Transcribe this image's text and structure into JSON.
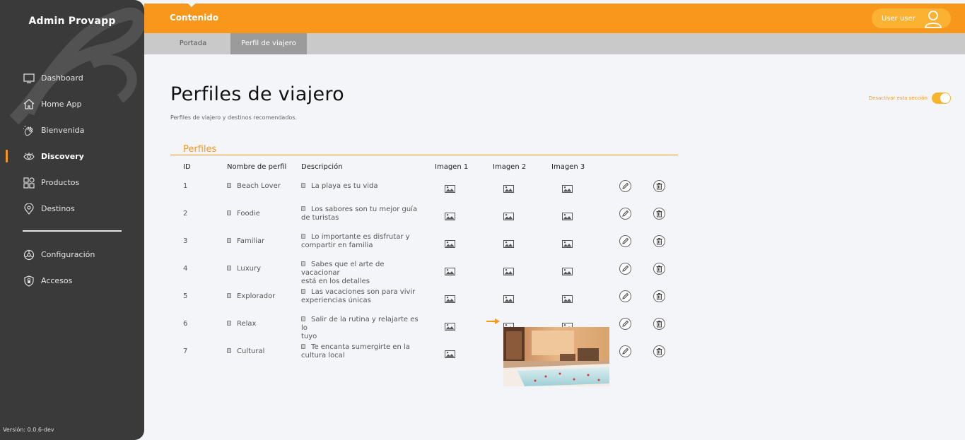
{
  "app": {
    "brand": "Admin Provapp",
    "version": "Versión: 0.0.6-dev"
  },
  "sidebar": {
    "items": [
      {
        "label": "Dashboard",
        "icon": "monitor-icon"
      },
      {
        "label": "Home App",
        "icon": "home-icon"
      },
      {
        "label": "Bienvenida",
        "icon": "wave-hand-icon"
      },
      {
        "label": "Discovery",
        "icon": "eye-icon",
        "active": true
      },
      {
        "label": "Productos",
        "icon": "grid-icon"
      },
      {
        "label": "Destinos",
        "icon": "location-pin-icon"
      }
    ],
    "secondary": [
      {
        "label": "Configuración",
        "icon": "settings-icon"
      },
      {
        "label": "Accesos",
        "icon": "shield-icon"
      }
    ]
  },
  "topbar": {
    "title": "Contenido",
    "user": "User user"
  },
  "tabs": [
    {
      "label": "Portada"
    },
    {
      "label": "Perfil de viajero",
      "active": true
    }
  ],
  "page": {
    "title": "Perfiles de viajero",
    "subtitle": "Perfiles de viajero y destinos recomendados.",
    "toggle_label": "Desactivar esta sección",
    "toggle_on": true
  },
  "section": {
    "title": "Perfiles"
  },
  "table": {
    "headers": {
      "id": "ID",
      "name": "Nombre de perfil",
      "desc": "Descripción",
      "img1": "Imagen 1",
      "img2": "Imagen 2",
      "img3": "Imagen 3"
    },
    "rows": [
      {
        "id": "1",
        "name": "Beach Lover",
        "desc": "La playa es tu vida",
        "desc2": ""
      },
      {
        "id": "2",
        "name": "Foodie",
        "desc": "Los sabores son tu mejor guía",
        "desc2": "de turistas"
      },
      {
        "id": "3",
        "name": "Familiar",
        "desc": "Lo importante es disfrutar y",
        "desc2": "compartir en familia"
      },
      {
        "id": "4",
        "name": "Luxury",
        "desc": "Sabes que el arte de vacacionar",
        "desc2": "está en los detalles"
      },
      {
        "id": "5",
        "name": "Explorador",
        "desc": "Las vacaciones son para vivir",
        "desc2": "experiencias únicas"
      },
      {
        "id": "6",
        "name": "Relax",
        "desc": "Salir de la rutina y relajarte es lo",
        "desc2": "tuyo"
      },
      {
        "id": "7",
        "name": "Cultural",
        "desc": "Te encanta sumergirte en la",
        "desc2": "cultura local"
      }
    ]
  },
  "colors": {
    "accent": "#f7981d",
    "sidebar": "#3a3a3a",
    "tabs": "#c9c9c9",
    "tab_active": "#9b9b9b"
  }
}
